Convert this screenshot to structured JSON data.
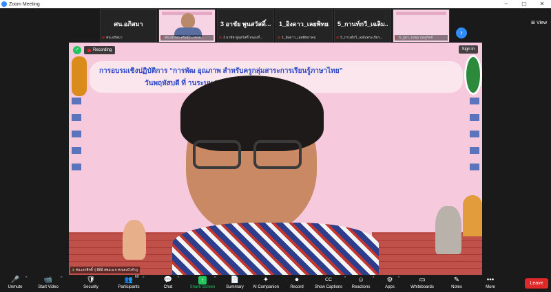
{
  "window": {
    "title": "Zoom Meeting",
    "controls": [
      "–",
      "▢",
      "✕"
    ]
  },
  "thumbnails": [
    {
      "type": "name",
      "label": "ศน.อภิสมา",
      "footer": "ศน.อภิสมา"
    },
    {
      "type": "video",
      "footer": "ศน.ณภัทร ศรีหมึก / ศกศ..."
    },
    {
      "type": "name",
      "label": "3 อาชัย พูนสวัสดิ์...",
      "footer": "3 อาชัย พูนสวัสดิ์ หนองกี่..."
    },
    {
      "type": "name",
      "label": "1_อิงดาว_เลยพิทย...",
      "footer": "1_อิงดาว_เลยพิทยาคม"
    },
    {
      "type": "name",
      "label": "5_กานท์กวี_เฉลิม...",
      "footer": "5_กานท์กวี_เฉลิมพระเกียร..."
    },
    {
      "type": "video",
      "footer": "6_ภูผา_ธงธุม กุดสูกิตย์"
    }
  ],
  "next_label": "›",
  "view_label": "⊞ View",
  "stage": {
    "recording_label": "Recording",
    "signin_label": "Sign in",
    "banner_line1": "การอบรมเชิงปฏิบัติการ “การพัฒ              อุณภาพ สำหรับครูกลุ่มสาระการเรียนรู้ภาษาไทย”",
    "banner_line2": "วันพฤหัสบดี ที่                        านระบบ Zoom Meeting",
    "speaker_label": "ศน.เอกสิทธิ์ รุ่ มีผ้อ้ สพม.ม.จ ทเนองบัวลำภู"
  },
  "toolbar": [
    {
      "id": "unmute",
      "label": "Unmute",
      "icon": "🎤",
      "red": true,
      "caret": true
    },
    {
      "id": "start-video",
      "label": "Start Video",
      "icon": "📹",
      "red": true,
      "caret": true
    },
    {
      "id": "security",
      "label": "Security",
      "icon": "🛡"
    },
    {
      "id": "participants",
      "label": "Participants",
      "icon": "👥",
      "count": "60",
      "caret": true
    },
    {
      "id": "chat",
      "label": "Chat",
      "icon": "💬",
      "caret": true
    },
    {
      "id": "share-screen",
      "label": "Share Screen",
      "icon": "↑",
      "caret": true
    },
    {
      "id": "summary",
      "label": "Summary",
      "icon": "📄"
    },
    {
      "id": "ai-companion",
      "label": "AI Companion",
      "icon": "✦"
    },
    {
      "id": "record",
      "label": "Record",
      "icon": "⏺"
    },
    {
      "id": "show-captions",
      "label": "Show Captions",
      "icon": "CC",
      "caret": true
    },
    {
      "id": "reactions",
      "label": "Reactions",
      "icon": "☺",
      "caret": true
    },
    {
      "id": "apps",
      "label": "Apps",
      "icon": "⚙",
      "caret": true
    },
    {
      "id": "whiteboards",
      "label": "Whiteboards",
      "icon": "▭"
    },
    {
      "id": "notes",
      "label": "Notes",
      "icon": "✎"
    },
    {
      "id": "more",
      "label": "More",
      "icon": "•••"
    }
  ],
  "leave_label": "Leave",
  "colors": {
    "accent": "#2d8cff",
    "leave": "#e02828",
    "share": "#23c55e",
    "stage_bg": "#f6c9dd"
  }
}
